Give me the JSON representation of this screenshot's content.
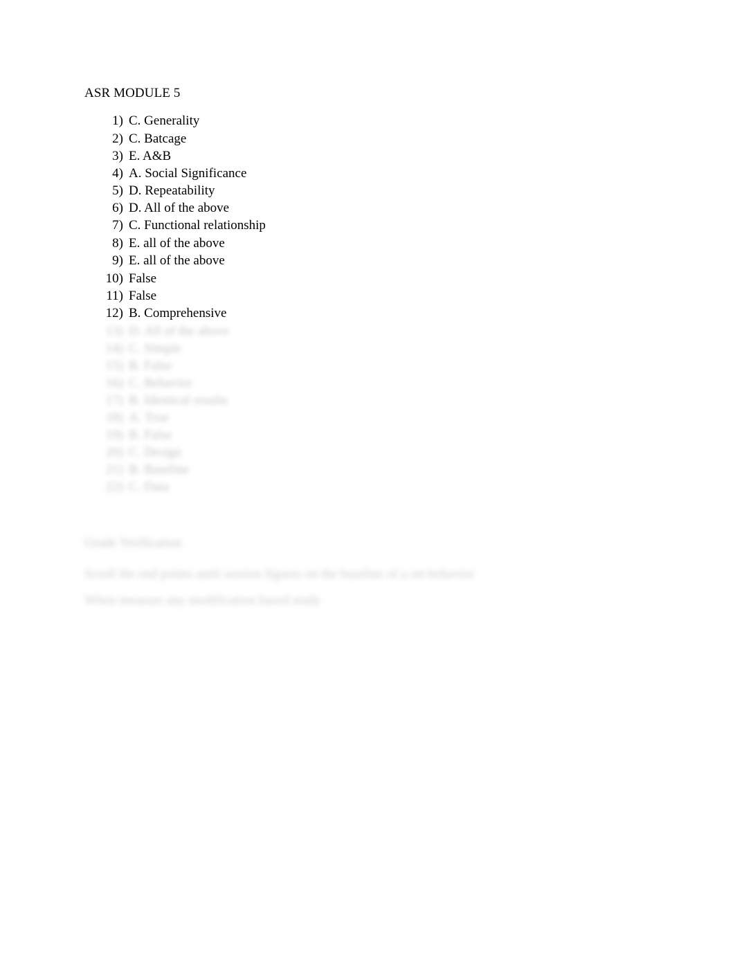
{
  "document": {
    "title": "ASR MODULE 5"
  },
  "answers": [
    {
      "number": "1)",
      "text": "C. Generality"
    },
    {
      "number": "2)",
      "text": "C. Batcage"
    },
    {
      "number": "3)",
      "text": "E. A&B"
    },
    {
      "number": "4)",
      "text": "A. Social Significance"
    },
    {
      "number": "5)",
      "text": "D. Repeatability"
    },
    {
      "number": "6)",
      "text": "D. All of the above"
    },
    {
      "number": "7)",
      "text": "C. Functional relationship"
    },
    {
      "number": "8)",
      "text": "E. all of the above"
    },
    {
      "number": "9)",
      "text": "E. all of the above"
    },
    {
      "number": "10)",
      "text": "False"
    },
    {
      "number": "11)",
      "text": "False"
    },
    {
      "number": "12)",
      "text": "B. Comprehensive"
    }
  ],
  "redacted_answers": [
    {
      "number": "13)",
      "text": "D. All of the above"
    },
    {
      "number": "14)",
      "text": "C. Simple"
    },
    {
      "number": "15)",
      "text": "B. False"
    },
    {
      "number": "16)",
      "text": "C. Behavior"
    },
    {
      "number": "17)",
      "text": "B. Identical results"
    },
    {
      "number": "18)",
      "text": "A. True"
    },
    {
      "number": "19)",
      "text": "B. False"
    },
    {
      "number": "20)",
      "text": "C. Design"
    },
    {
      "number": "21)",
      "text": "B. Baseline"
    },
    {
      "number": "22)",
      "text": "C. Data"
    }
  ],
  "redacted_block": {
    "heading": "Grade Verification",
    "lines": [
      "Scroll the end points until session figures on the baseline of a set behavior",
      "When measure any modification based study"
    ]
  }
}
